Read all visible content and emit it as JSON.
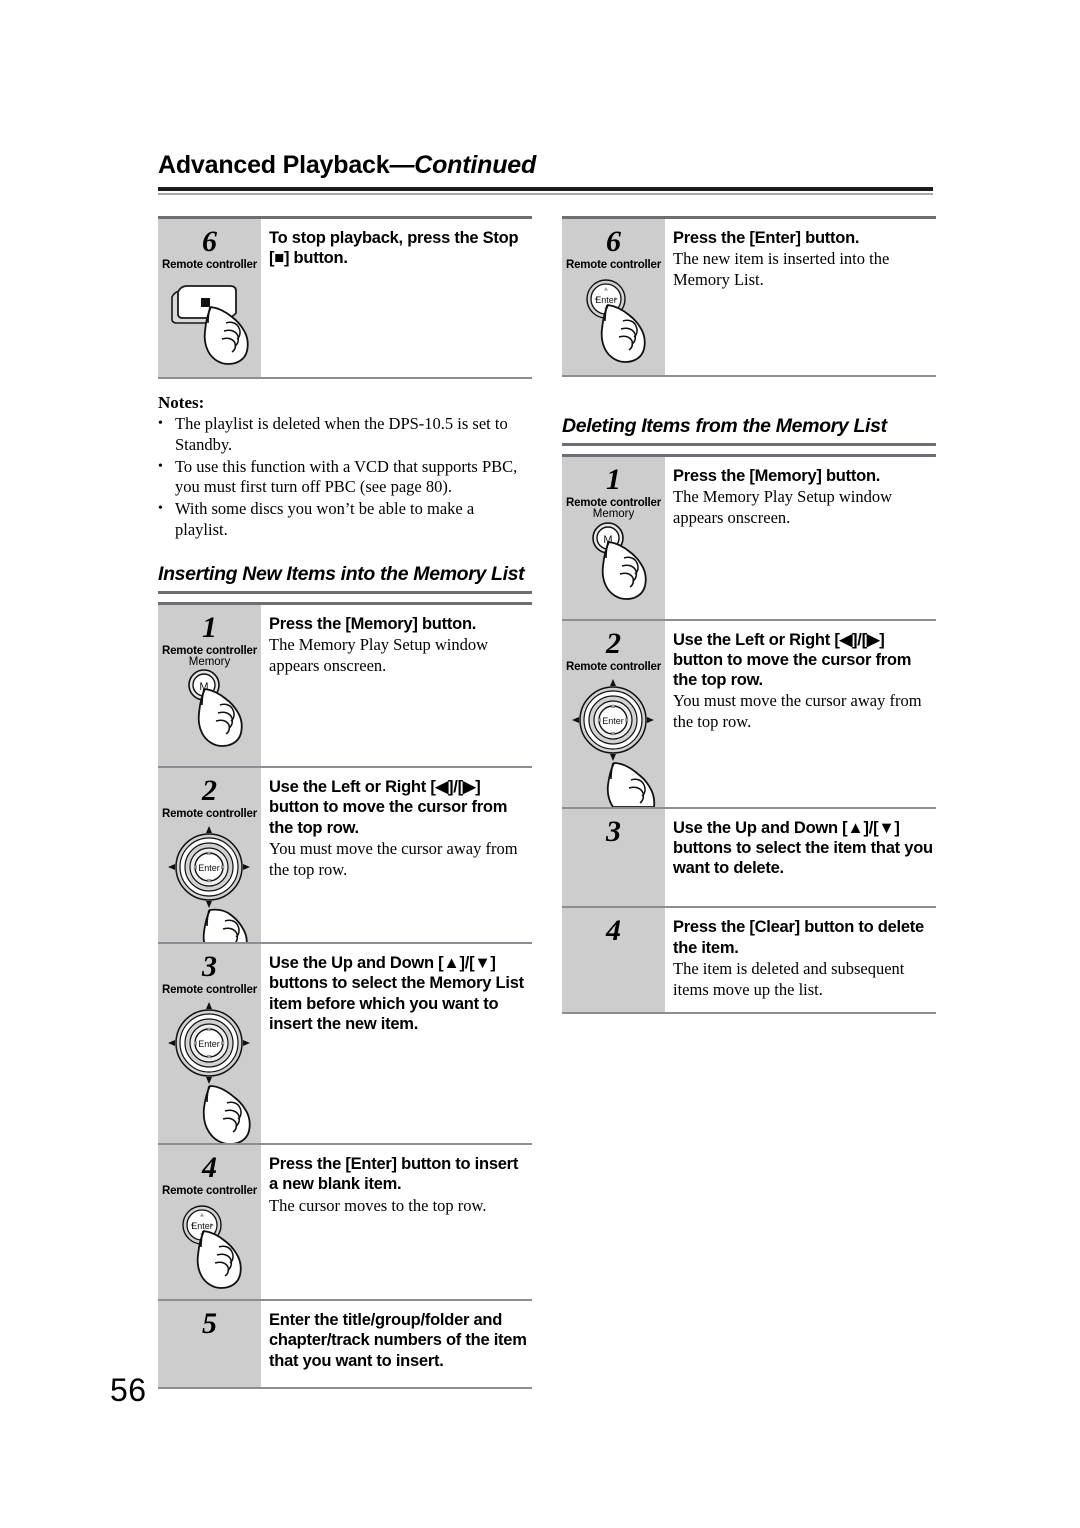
{
  "header": {
    "title_main": "Advanced Playback",
    "title_cont": "—Continued"
  },
  "page_number": "56",
  "labels": {
    "device": "Remote controller",
    "memory_caption": "Memory",
    "enter_caption": "Enter",
    "memory_glyph": "M"
  },
  "left_column": {
    "top_step": {
      "number": "6",
      "device": "Remote controller",
      "title": "To stop playback, press the Stop [■] button.",
      "desc": "",
      "icon": "stop-button-press-illustration"
    },
    "notes": {
      "heading": "Notes:",
      "items": [
        "The playlist is deleted when the DPS-10.5 is set to Standby.",
        "To use this function with a VCD that supports PBC, you must first turn off PBC (see page 80).",
        "With some discs you won’t be able to make a playlist."
      ]
    },
    "section": {
      "title": "Inserting New Items into the Memory List",
      "steps": [
        {
          "number": "1",
          "device": "Remote controller",
          "title": "Press the [Memory] button.",
          "desc": "The Memory Play Setup window appears onscreen.",
          "icon": "memory-button-press-illustration"
        },
        {
          "number": "2",
          "device": "Remote controller",
          "title": "Use the Left or Right [◀]/[▶] button to move the cursor from the top row.",
          "desc": "You must move the cursor away from the top row.",
          "icon": "dpad-press-illustration"
        },
        {
          "number": "3",
          "device": "Remote controller",
          "title": "Use the Up and Down [▲]/[▼] buttons to select the Memory List item before which you want to insert the new item.",
          "desc": "",
          "icon": "dpad-press-illustration"
        },
        {
          "number": "4",
          "device": "Remote controller",
          "title": "Press the [Enter] button to insert a new blank item.",
          "desc": "The cursor moves to the top row.",
          "icon": "enter-button-press-illustration"
        },
        {
          "number": "5",
          "device": "",
          "title": "Enter the title/group/folder and chapter/track numbers of the item that you want to insert.",
          "desc": "",
          "icon": ""
        }
      ]
    }
  },
  "right_column": {
    "top_step": {
      "number": "6",
      "device": "Remote controller",
      "title": "Press the [Enter] button.",
      "desc": "The new item is inserted into the Memory List.",
      "icon": "enter-button-press-illustration"
    },
    "section": {
      "title": "Deleting Items from the Memory List",
      "steps": [
        {
          "number": "1",
          "device": "Remote controller",
          "title": "Press the [Memory] button.",
          "desc": "The Memory Play Setup window appears onscreen.",
          "icon": "memory-button-press-illustration"
        },
        {
          "number": "2",
          "device": "Remote controller",
          "title": "Use the Left or Right [◀]/[▶] button to move the cursor from the top row.",
          "desc": "You must move the cursor away from the top row.",
          "icon": "dpad-press-illustration"
        },
        {
          "number": "3",
          "device": "",
          "title": "Use the Up and Down [▲]/[▼] buttons to select the item that you want to delete.",
          "desc": "",
          "icon": ""
        },
        {
          "number": "4",
          "device": "",
          "title": "Press the [Clear] button to delete the item.",
          "desc": "The item is deleted and subsequent items move up the list.",
          "icon": ""
        }
      ]
    }
  },
  "colors": {
    "gutter_gray": "#cdcdcd",
    "rule_gray": "#6e6e76",
    "text_black": "#000000"
  }
}
